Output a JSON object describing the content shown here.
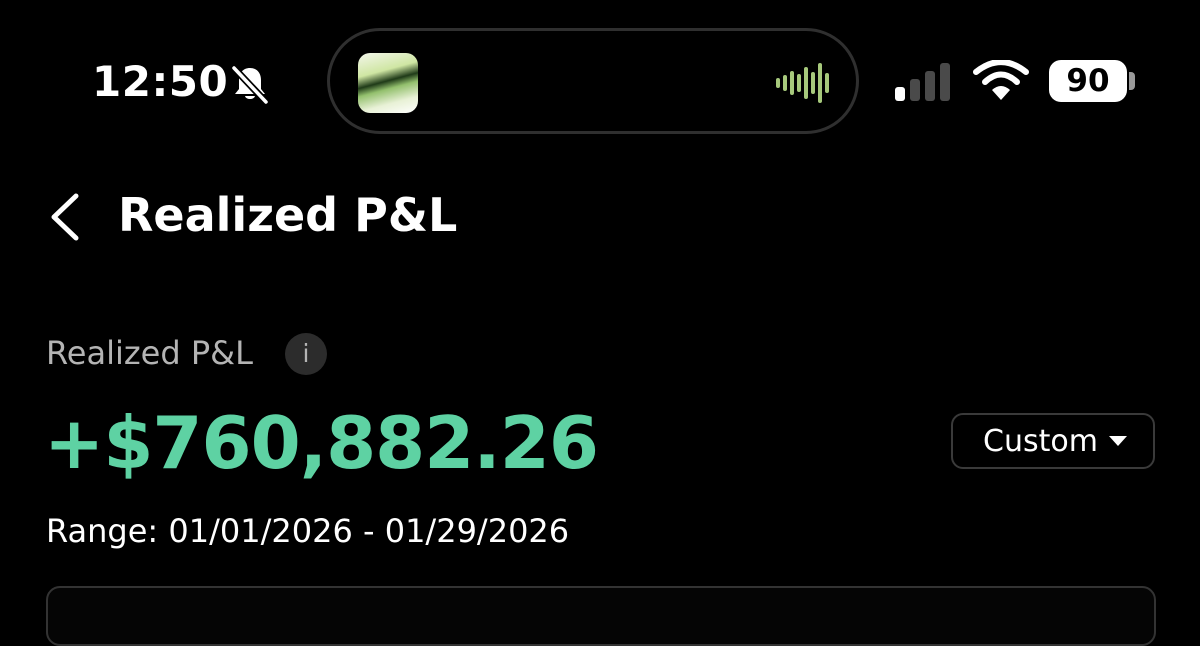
{
  "status_bar": {
    "time": "12:50",
    "battery_level": "90",
    "silent_icon": "bell-slash-icon",
    "signal_icon": "cellular-signal-icon",
    "wifi_icon": "wifi-icon"
  },
  "live_activity": {
    "artwork_icon": "album-artwork",
    "waveform_icon": "audio-waveform-icon"
  },
  "nav": {
    "back_icon": "chevron-left-icon",
    "title": "Realized P&L"
  },
  "summary": {
    "label": "Realized P&L",
    "info_glyph": "i",
    "value": "+$760,882.26",
    "range_selector": "Custom",
    "range_text": "Range: 01/01/2026 - 01/29/2026"
  },
  "colors": {
    "positive": "#5ed2a3",
    "background": "#000000",
    "secondary_text": "#b4b4b4"
  }
}
